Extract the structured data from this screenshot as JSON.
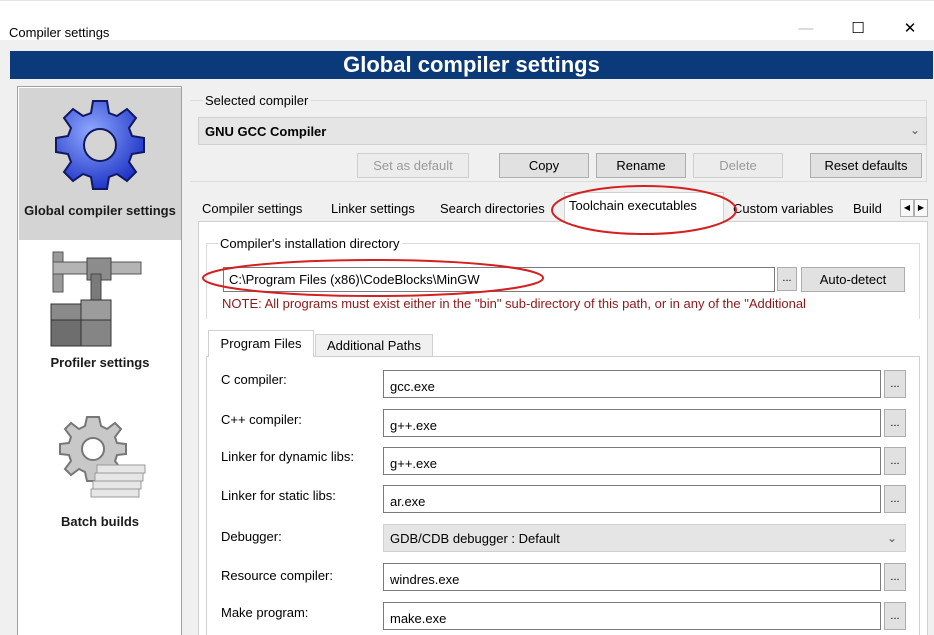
{
  "window": {
    "title": "Compiler settings",
    "minimize_icon": "—",
    "maximize_icon": "☐",
    "close_icon": "✕"
  },
  "banner": "Global compiler settings",
  "sidebar": {
    "items": [
      {
        "label": "Global compiler settings",
        "icon": "gear-icon"
      },
      {
        "label": "Profiler settings",
        "icon": "caliper-icon"
      },
      {
        "label": "Batch builds",
        "icon": "gear-stack-icon"
      }
    ]
  },
  "selected_compiler": {
    "label": "Selected compiler",
    "value": "GNU GCC Compiler",
    "buttons": {
      "set_default": "Set as default",
      "copy": "Copy",
      "rename": "Rename",
      "delete": "Delete",
      "reset": "Reset defaults"
    }
  },
  "tabs": [
    "Compiler settings",
    "Linker settings",
    "Search directories",
    "Toolchain executables",
    "Custom variables",
    "Build"
  ],
  "toolchain": {
    "install_dir_label": "Compiler's installation directory",
    "install_dir_value": "C:\\Program Files (x86)\\CodeBlocks\\MinGW",
    "browse_label": "...",
    "auto_detect": "Auto-detect",
    "note": "NOTE: All programs must exist either in the \"bin\" sub-directory of this path, or in any of the \"Additional",
    "inner_tabs": [
      "Program Files",
      "Additional Paths"
    ],
    "programs": [
      {
        "label": "C compiler:",
        "value": "gcc.exe"
      },
      {
        "label": "C++ compiler:",
        "value": "g++.exe"
      },
      {
        "label": "Linker for dynamic libs:",
        "value": "g++.exe"
      },
      {
        "label": "Linker for static libs:",
        "value": "ar.exe"
      },
      {
        "label": "Debugger:",
        "value": "GDB/CDB debugger : Default"
      },
      {
        "label": "Resource compiler:",
        "value": "windres.exe"
      },
      {
        "label": "Make program:",
        "value": "make.exe"
      }
    ]
  },
  "colors": {
    "banner_bg": "#0b3a7a",
    "annotation_red": "#d42020",
    "note_text": "#8a1a1a"
  }
}
